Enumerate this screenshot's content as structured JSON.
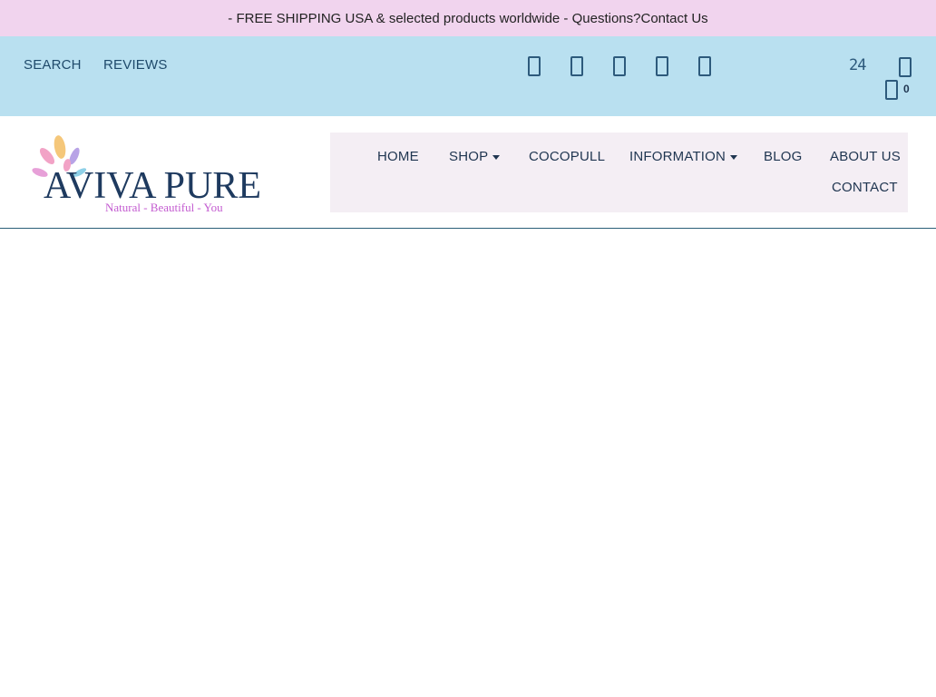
{
  "announcement": {
    "text": "- FREE SHIPPING USA & selected products worldwide - Questions? ",
    "contact_link": "Contact Us"
  },
  "topbar": {
    "search_label": "SEARCH",
    "reviews_label": "REVIEWS",
    "social_icons": [
      "facebook-icon",
      "instagram-icon",
      "pinterest-icon",
      "twitter-icon",
      "youtube-icon"
    ],
    "hours_badge": "24",
    "cart_count": "0"
  },
  "brand": {
    "name": "AVIVA PURE",
    "tagline": "Natural - Beautiful - You",
    "colors": {
      "name": "#1e3a5f",
      "tagline": "#c35bd0",
      "petals": [
        "#f5c77a",
        "#f2a3c6",
        "#b8a3e6",
        "#8fd1e8",
        "#e7a0d8"
      ]
    }
  },
  "nav": {
    "items": [
      "HOME",
      "SHOP",
      "COCOPULL",
      "INFORMATION",
      "BLOG",
      "ABOUT US",
      "CONTACT"
    ]
  },
  "colors": {
    "announcement_bg": "#f1d4ee",
    "topbar_bg": "#b9e0f0",
    "nav_bg": "#f4eef4",
    "text": "#1f3550"
  }
}
